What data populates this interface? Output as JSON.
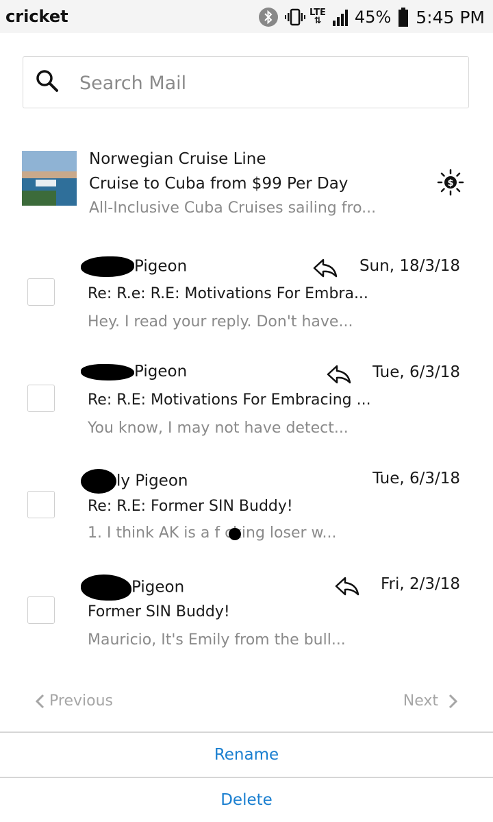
{
  "status_bar": {
    "carrier": "cricket",
    "network": "LTE",
    "battery": "45%",
    "time": "5:45 PM"
  },
  "search": {
    "placeholder": "Search Mail"
  },
  "ad": {
    "sender": "Norwegian Cruise Line",
    "subject": "Cruise to Cuba from $99 Per Day",
    "preview": "All-Inclusive Cuba Cruises sailing fro..."
  },
  "messages": [
    {
      "sender": "Pigeon",
      "date": "Sun, 18/3/18",
      "replied": true,
      "subject": "Re: R.e: R.E: Motivations For Embra...",
      "preview": "Hey. I read your reply. Don't have..."
    },
    {
      "sender": "Pigeon",
      "date": "Tue, 6/3/18",
      "replied": true,
      "subject": "Re: R.E: Motivations For Embracing ...",
      "preview": "You know, I may not have detect..."
    },
    {
      "sender": "ly Pigeon",
      "date": "Tue, 6/3/18",
      "replied": false,
      "subject": "Re: R.E: Former SIN Buddy!",
      "preview": "1. I think AK is a f  cking loser w..."
    },
    {
      "sender": "Pigeon",
      "date": "Fri, 2/3/18",
      "replied": true,
      "subject": "Former SIN Buddy!",
      "preview": "Mauricio, It's Emily from the bull..."
    }
  ],
  "pagination": {
    "previous": "Previous",
    "next": "Next"
  },
  "actions": {
    "rename": "Rename",
    "delete": "Delete"
  },
  "colors": {
    "action_blue": "#1a7fd0",
    "muted_text": "#8a8a8a"
  }
}
